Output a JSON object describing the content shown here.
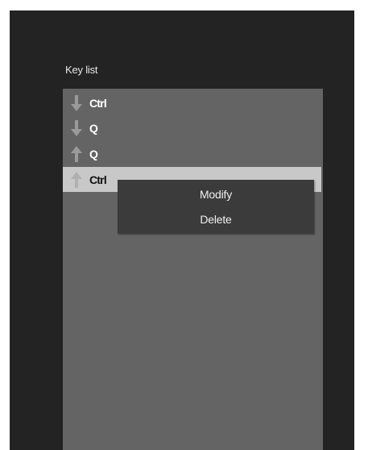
{
  "window": {
    "colors": {
      "window_bg": "#232323",
      "list_bg": "#646464",
      "selected_bg": "#c8c8c8",
      "menu_bg": "#3b3b3b",
      "arrow_color": "#9a9a9a"
    }
  },
  "key_list": {
    "label": "Key list",
    "items": [
      {
        "label": "Ctrl",
        "direction": "down",
        "icon": "arrow-down-icon",
        "selected": false
      },
      {
        "label": "Q",
        "direction": "down",
        "icon": "arrow-down-icon",
        "selected": false
      },
      {
        "label": "Q",
        "direction": "up",
        "icon": "arrow-up-icon",
        "selected": false
      },
      {
        "label": "Ctrl",
        "direction": "up",
        "icon": "arrow-up-icon",
        "selected": true
      }
    ]
  },
  "context_menu": {
    "items": [
      {
        "label": "Modify"
      },
      {
        "label": "Delete"
      }
    ]
  }
}
